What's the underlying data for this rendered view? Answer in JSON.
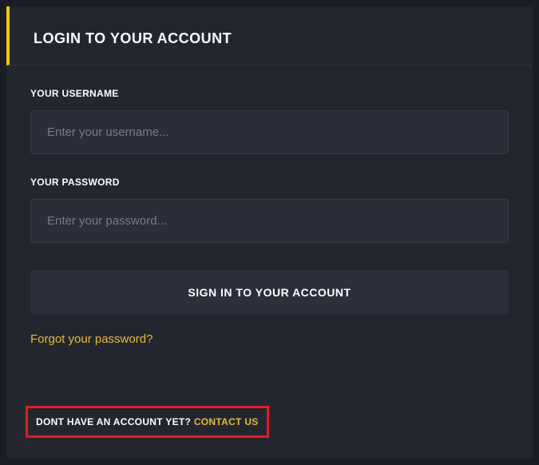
{
  "header": {
    "title": "LOGIN TO YOUR ACCOUNT"
  },
  "form": {
    "username": {
      "label": "YOUR USERNAME",
      "placeholder": "Enter your username...",
      "value": ""
    },
    "password": {
      "label": "YOUR PASSWORD",
      "placeholder": "Enter your password...",
      "value": ""
    },
    "submit_label": "SIGN IN TO YOUR ACCOUNT",
    "forgot_label": "Forgot your password?"
  },
  "footer": {
    "prompt": "DONT HAVE AN ACCOUNT YET? ",
    "link_label": "CONTACT US"
  },
  "colors": {
    "accent": "#f1c40f",
    "highlight_border": "#e31b23"
  }
}
